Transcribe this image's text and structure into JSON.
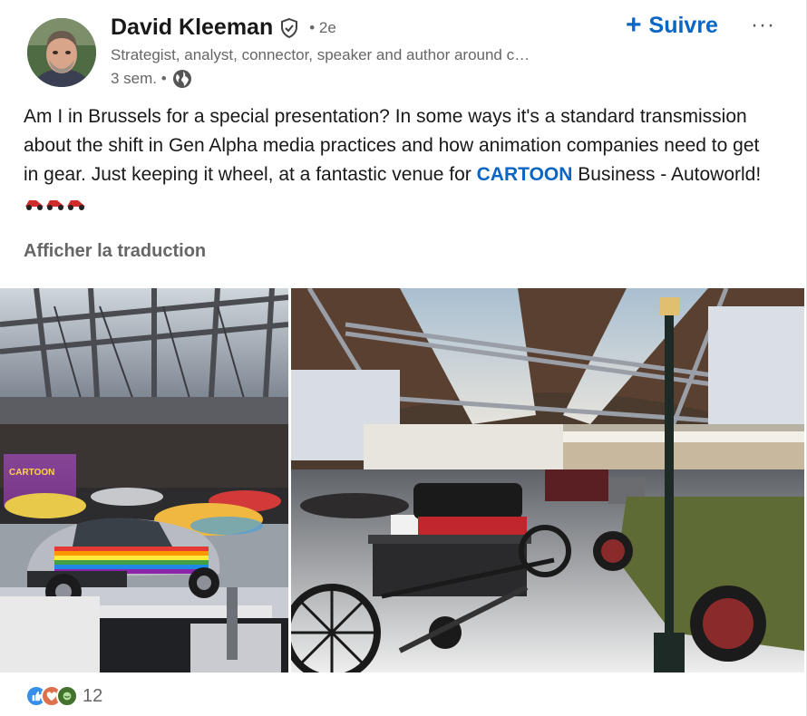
{
  "author": {
    "name": "David Kleeman",
    "degree": "• 2e",
    "headline": "Strategist, analyst, connector, speaker and author around c…",
    "time": "3 sem. •"
  },
  "actions": {
    "follow_label": "Suivre",
    "follow_icon": "+",
    "more_label": "···"
  },
  "post": {
    "text_before": "Am I in Brussels for a special presentation? In some ways it's a standard transmission about the shift in Gen Alpha media practices and how animation companies need to get in gear. Just keeping it wheel, at a fantastic venue for ",
    "tag": "CARTOON",
    "text_after": " Business - Autoworld! ",
    "translate_label": "Afficher la traduction"
  },
  "images": {
    "left_sign": "CARTOON",
    "right_alt": "Autoworld hall"
  },
  "reactions": {
    "count": "12",
    "icons": [
      "like-icon",
      "love-icon",
      "support-icon"
    ]
  },
  "colors": {
    "accent": "#0a66c2",
    "muted": "#666666"
  }
}
